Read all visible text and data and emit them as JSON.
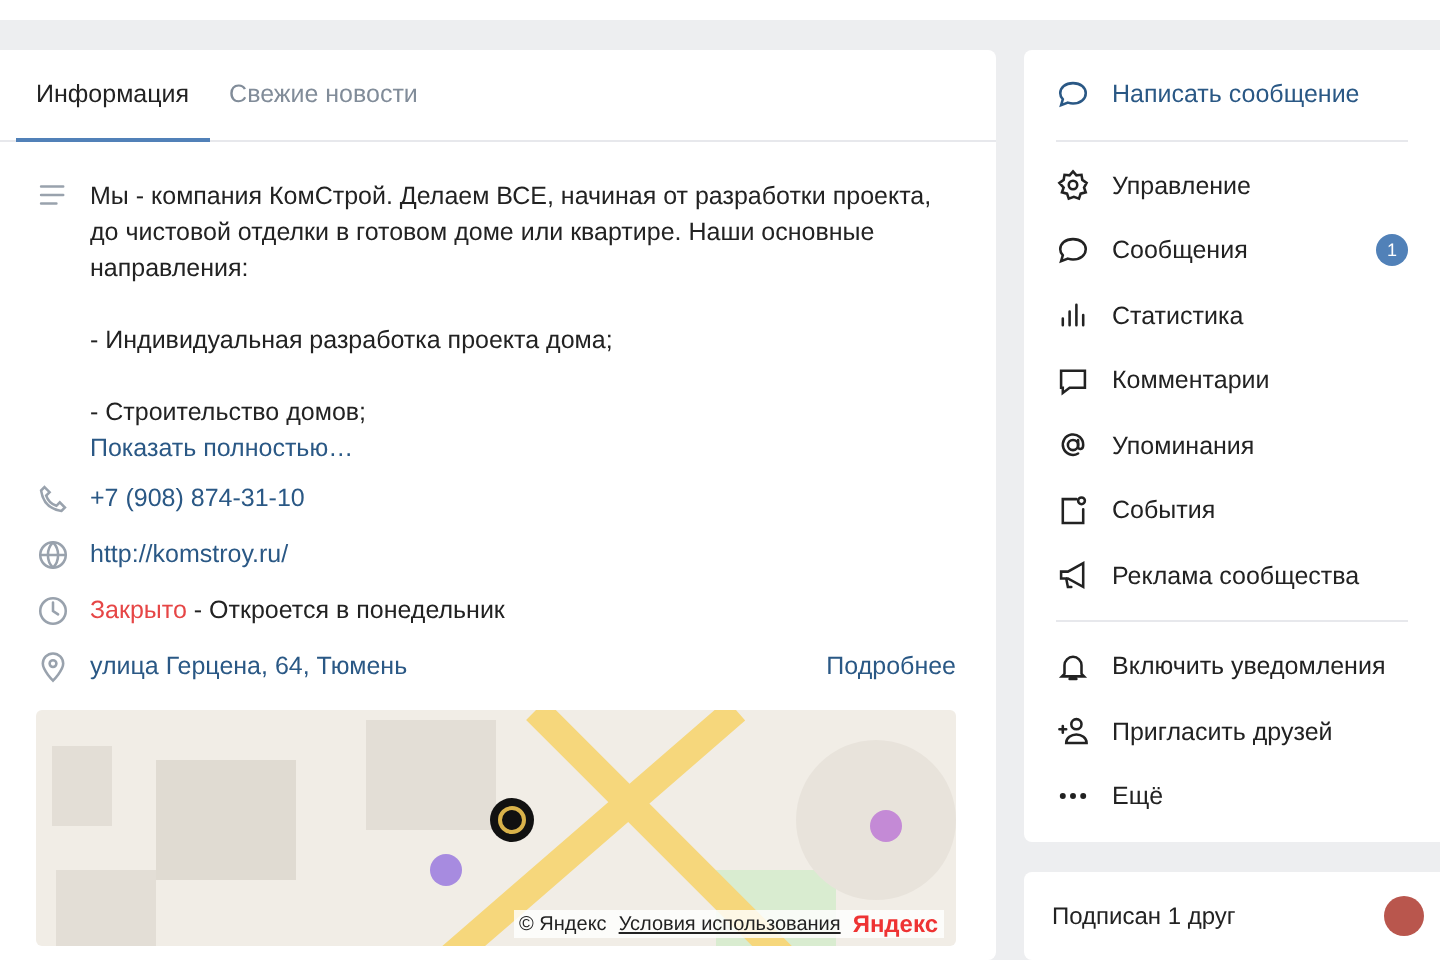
{
  "tabs": [
    {
      "label": "Информация",
      "selected": true
    },
    {
      "label": "Свежие новости",
      "selected": false
    }
  ],
  "description": {
    "text": "Мы - компания КомСтрой. Делаем ВСЕ, начиная от разработки проекта, до чистовой отделки в готовом доме или квартире. Наши основные направления:\n\n- Индивидуальная разработка проекта дома;\n\n- Строительство домов;",
    "more": "Показать полностью…"
  },
  "info_rows": [
    {
      "kind": "phone",
      "text": "+7 (908) 874-31-10"
    },
    {
      "kind": "site",
      "text": "http://komstroy.ru/"
    },
    {
      "kind": "hours",
      "status": "Закрыто",
      "text": " - Откроется в понедельник"
    },
    {
      "kind": "address",
      "text": "улица Герцена, 64, Тюмень",
      "link": "Подробнее"
    }
  ],
  "map": {
    "copyright": "© Яндекс",
    "terms": "Условия использования",
    "logo": "Яндекс"
  },
  "actions": [
    {
      "kind": "write",
      "label": "Написать сообщение"
    }
  ],
  "menu": [
    {
      "kind": "gear",
      "label": "Управление"
    },
    {
      "kind": "chat",
      "label": "Сообщения",
      "badge": "1"
    },
    {
      "kind": "stats",
      "label": "Статистика"
    },
    {
      "kind": "comment",
      "label": "Комментарии"
    },
    {
      "kind": "at",
      "label": "Упоминания"
    },
    {
      "kind": "event",
      "label": "События"
    },
    {
      "kind": "megaphone",
      "label": "Реклама сообщества"
    }
  ],
  "extra_menu": [
    {
      "kind": "bell",
      "label": "Включить уведомления"
    },
    {
      "kind": "invite",
      "label": "Пригласить друзей"
    },
    {
      "kind": "dots",
      "label": "Ещё"
    }
  ],
  "friends": {
    "label": "Подписан 1 друг"
  }
}
